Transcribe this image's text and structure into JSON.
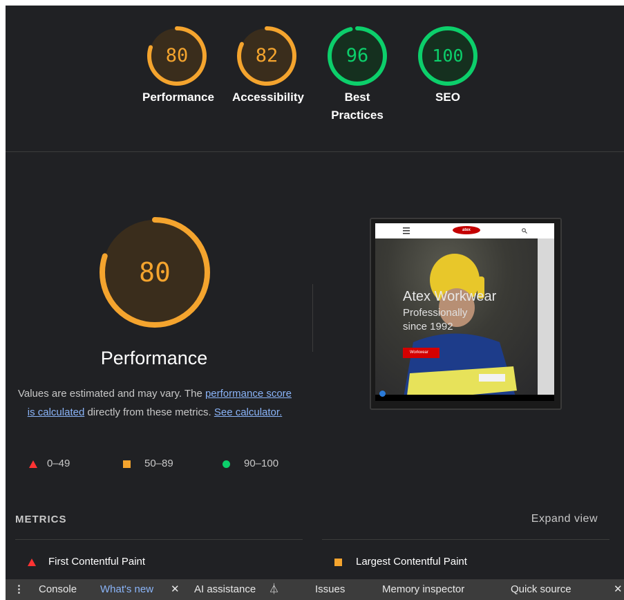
{
  "categories": [
    {
      "score": "80",
      "label": "Performance",
      "color": "#f4a42e",
      "fill": 0.8
    },
    {
      "score": "82",
      "label": "Accessibility",
      "color": "#f4a42e",
      "fill": 0.82
    },
    {
      "score": "96",
      "label": "Best Practices",
      "color": "#0ccf6b",
      "fill": 0.96
    },
    {
      "score": "100",
      "label": "SEO",
      "color": "#0ccf6b",
      "fill": 1.0
    }
  ],
  "performance": {
    "score": "80",
    "fill": 0.8,
    "title": "Performance",
    "desc_1": "Values are estimated and may vary. The ",
    "link_1": "performance score is calculated",
    "desc_2": " directly from these metrics. ",
    "link_2": "See calculator.",
    "legend": {
      "poor": "0–49",
      "average": "50–89",
      "good": "90–100"
    }
  },
  "screenshot": {
    "brand": "atex",
    "hero_title": "Atex Workwear",
    "hero_sub": "Professionally since 1992",
    "hero_button": "Workwear"
  },
  "metrics": {
    "heading": "METRICS",
    "expand": "Expand view",
    "fcp": "First Contentful Paint",
    "lcp": "Largest Contentful Paint"
  },
  "devtools": {
    "console": "Console",
    "whats_new": "What's new",
    "ai": "AI assistance",
    "issues": "Issues",
    "memory": "Memory inspector",
    "quick_source": "Quick source"
  }
}
